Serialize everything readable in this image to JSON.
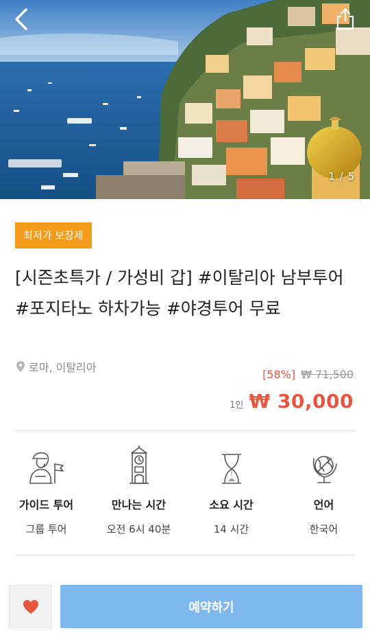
{
  "hero": {
    "image_description": "Positano coastal town on cliff with blue sea",
    "counter": "1 / 5",
    "back_icon": "chevron-left-icon",
    "share_icon": "share-icon"
  },
  "badge": "최저가 보장제",
  "title": "[시즌초특가 / 가성비 갑]  #이탈리아 남부투어 #포지타노 하차가능 #야경투어 무료",
  "location": "로마, 이탈리아",
  "pricing": {
    "discount": "[58%]",
    "original": "₩ 71,500",
    "per_person": "1인",
    "price": "₩ 30,000"
  },
  "info": [
    {
      "icon": "guide-icon",
      "label": "가이드 투어",
      "value": "그룹 투어"
    },
    {
      "icon": "clock-tower-icon",
      "label": "만나는 시간",
      "value": "오전 6시 40분"
    },
    {
      "icon": "hourglass-icon",
      "label": "소요 시간",
      "value": "14 시간"
    },
    {
      "icon": "globe-icon",
      "label": "언어",
      "value": "한국어"
    }
  ],
  "actions": {
    "wishlist_icon": "heart-icon",
    "book_label": "예약하기"
  },
  "colors": {
    "badge": "#f59b1c",
    "price": "#e8553f",
    "book_button": "#7fb8ef",
    "heart": "#e8553f"
  }
}
